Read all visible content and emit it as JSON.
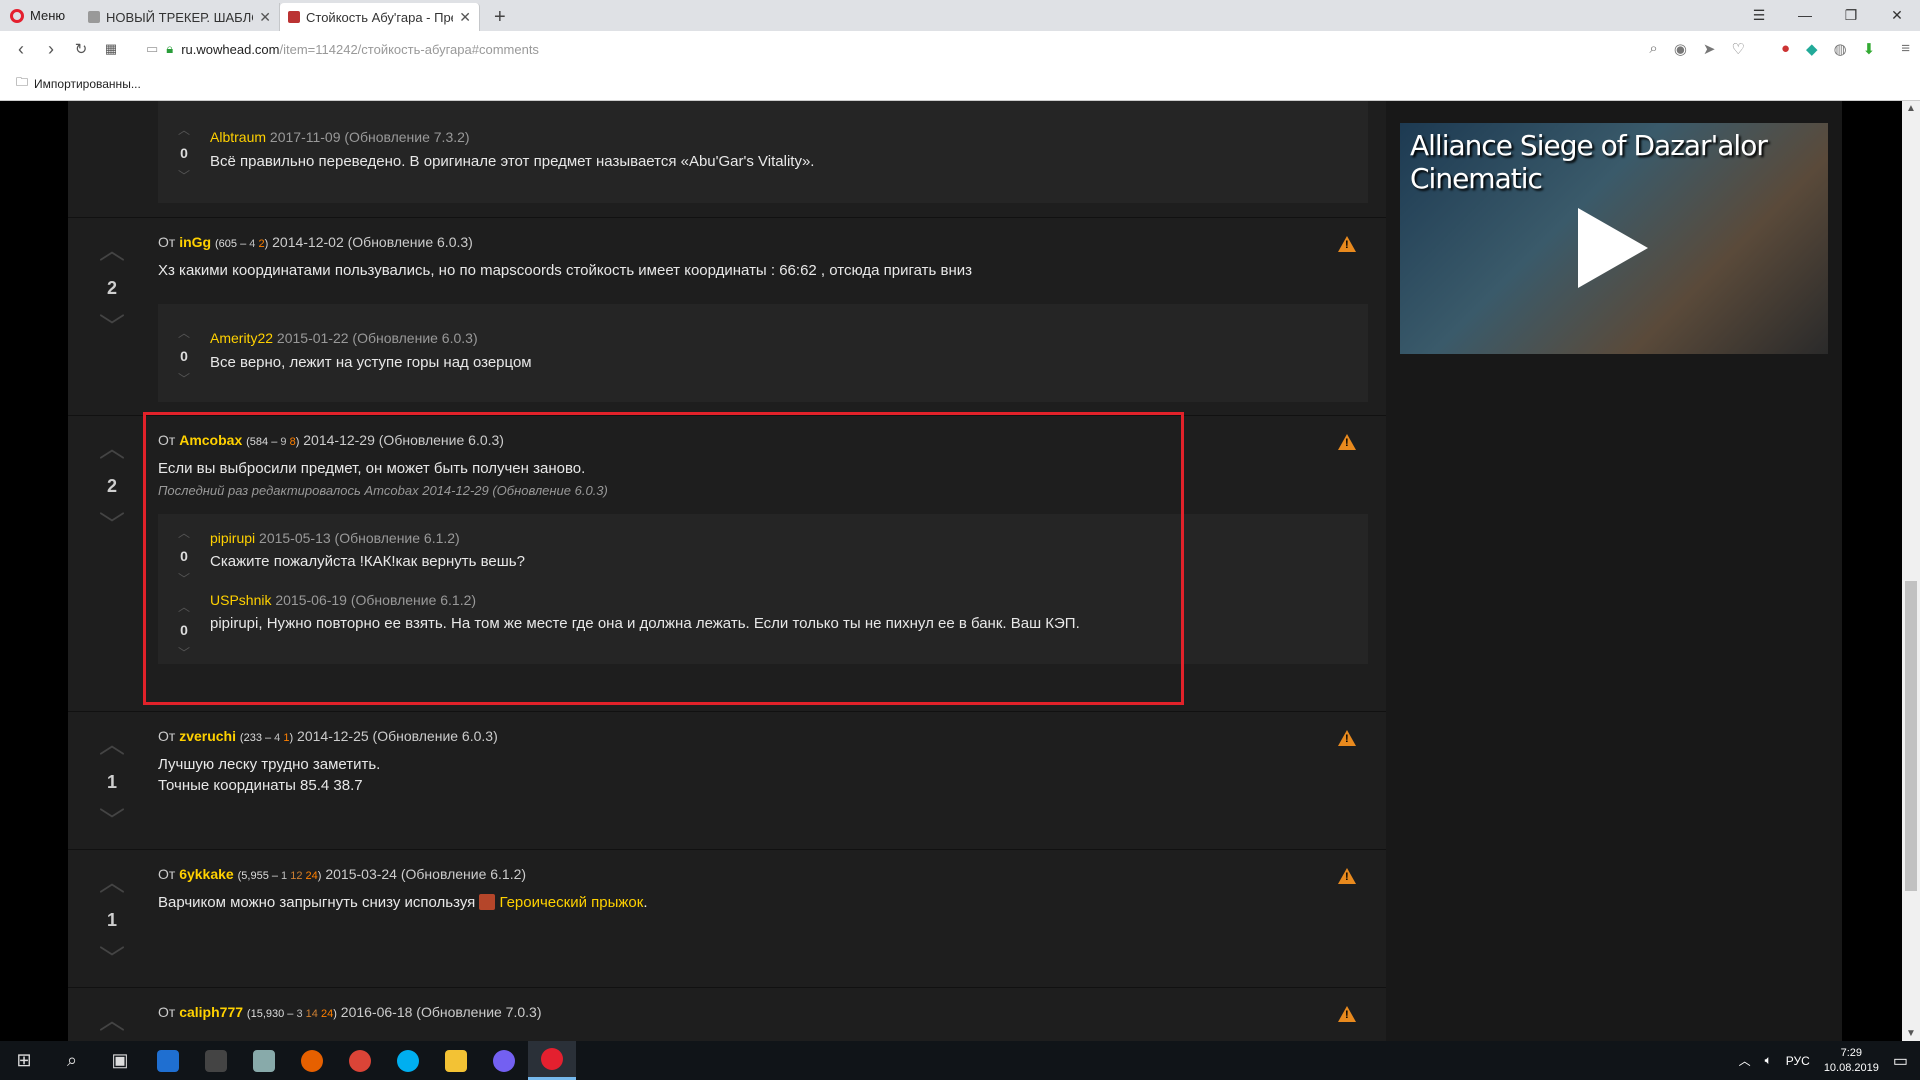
{
  "browser": {
    "menu_label": "Меню",
    "tabs": [
      {
        "title": "НОВЫЙ ТРЕКЕР. ШАБЛОН"
      },
      {
        "title": "Стойкость Абу'гара - Пре"
      }
    ],
    "url_domain": "ru.wowhead.com",
    "url_path": "/item=114242/стойкость-абугара#comments",
    "bookmark_label": "Импортированны..."
  },
  "sidebar": {
    "video_title": "Alliance Siege of Dazar'alor Cinematic"
  },
  "comments": [
    {
      "reply_only": true,
      "replies": [
        {
          "votes": "0",
          "user": "Albtraum",
          "meta": "2017-11-09 (Обновление 7.3.2)",
          "text": "Всё правильно переведено. В оригинале этот предмет называется «Abu'Gar's Vitality»."
        }
      ]
    },
    {
      "votes": "2",
      "by": "От",
      "user": "inGg",
      "rep_main": "605",
      "rep_sep": " – ",
      "rep_1": "4",
      "rep_2": "2",
      "meta": "2014-12-02 (Обновление 6.0.3)",
      "text": "Хз какими координатами пользувались, но по mapscoords стойкость имеет координаты : 66:62 , отсюда пригать вниз",
      "replies": [
        {
          "votes": "0",
          "user": "Amerity22",
          "meta": "2015-01-22 (Обновление 6.0.3)",
          "text": "Все верно, лежит на уступе горы над озерцом"
        }
      ]
    },
    {
      "votes": "2",
      "by": "От",
      "user": "Amcobax",
      "rep_main": "584",
      "rep_sep": " – ",
      "rep_1": "9",
      "rep_2": "8",
      "meta": "2014-12-29 (Обновление 6.0.3)",
      "text": "Если вы выбросили предмет, он может быть получен заново.",
      "edited": "Последний раз редактировалось Amcobax 2014-12-29 (Обновление 6.0.3)",
      "replies": [
        {
          "votes": "0",
          "user": "pipirupi",
          "meta": "2015-05-13 (Обновление 6.1.2)",
          "text": "Скажите пожалуйста !КАК!как вернуть вешь?"
        },
        {
          "votes": "0",
          "user": "USPshnik",
          "meta": "2015-06-19 (Обновление 6.1.2)",
          "text": "pipirupi, Нужно повторно ее взять. На том же месте где она и должна лежать. Если только ты не пихнул ее в банк. Ваш КЭП."
        }
      ]
    },
    {
      "votes": "1",
      "by": "От",
      "user": "zveruchi",
      "rep_main": "233",
      "rep_sep": " – ",
      "rep_1": "4",
      "rep_2": "1",
      "meta": "2014-12-25 (Обновление 6.0.3)",
      "text_lines": [
        "Лучшую леску трудно заметить.",
        "Точные координаты 85.4 38.7"
      ]
    },
    {
      "votes": "1",
      "by": "От",
      "user": "6ykkake",
      "rep_main": "5,955",
      "rep_sep": " – ",
      "rep_1": "1",
      "rep_2": "12",
      "rep_3": "24",
      "meta": "2015-03-24 (Обновление 6.1.2)",
      "text_prefix": "Варчиком можно запрыгнуть снизу используя",
      "spell_link": "Героический прыжок",
      "text_suffix": "."
    },
    {
      "votes": "",
      "by": "От",
      "user": "caliph777",
      "rep_main": "15,930",
      "rep_sep": " – ",
      "rep_1": "3",
      "rep_2": "14",
      "rep_3": "24",
      "meta": "2016-06-18 (Обновление 7.0.3)"
    }
  ],
  "taskbar": {
    "lang": "РУС",
    "time": "7:29",
    "date": "10.08.2019"
  },
  "colors": {
    "accent_user": "#ffd100",
    "warning": "#e98a1e",
    "highlight": "#e2222a"
  }
}
